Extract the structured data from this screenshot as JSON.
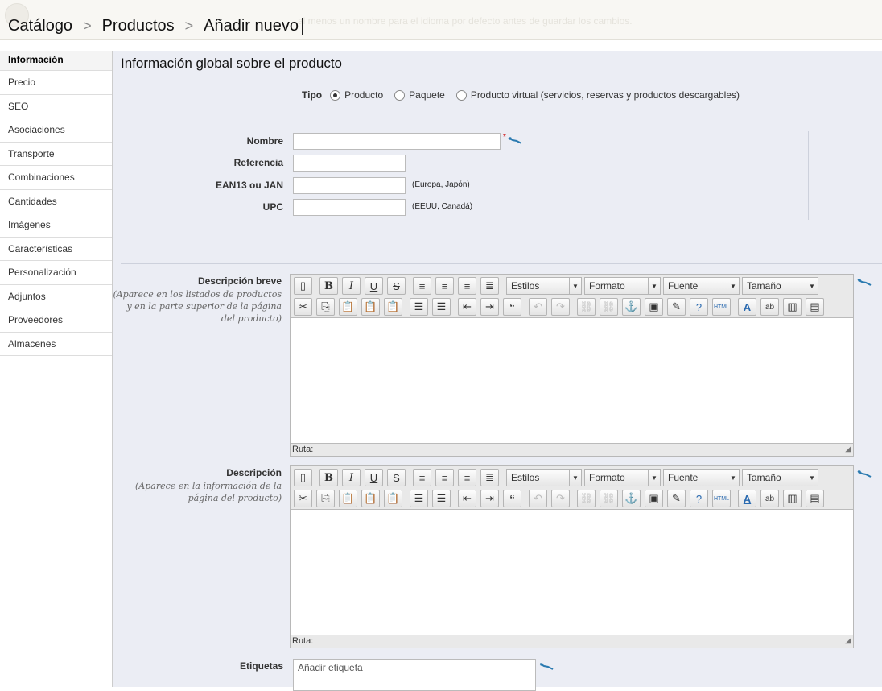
{
  "breadcrumb": {
    "items": [
      "Catálogo",
      "Productos",
      "Añadir nuevo"
    ],
    "separator": ">",
    "ghost_text": "al menos un nombre para el idioma por defecto antes de guardar los cambios."
  },
  "sidebar": {
    "items": [
      {
        "label": "Información"
      },
      {
        "label": "Precio"
      },
      {
        "label": "SEO"
      },
      {
        "label": "Asociaciones"
      },
      {
        "label": "Transporte"
      },
      {
        "label": "Combinaciones"
      },
      {
        "label": "Cantidades"
      },
      {
        "label": "Imágenes"
      },
      {
        "label": "Características"
      },
      {
        "label": "Personalización"
      },
      {
        "label": "Adjuntos"
      },
      {
        "label": "Proveedores"
      },
      {
        "label": "Almacenes"
      }
    ]
  },
  "main": {
    "title": "Información global sobre el producto",
    "tipo": {
      "label": "Tipo",
      "options": [
        "Producto",
        "Paquete",
        "Producto virtual (servicios, reservas y productos descargables)"
      ]
    },
    "fields": {
      "nombre": {
        "label": "Nombre",
        "value": "",
        "required": "*"
      },
      "referencia": {
        "label": "Referencia",
        "value": ""
      },
      "ean13": {
        "label": "EAN13 ou JAN",
        "value": "",
        "note": "(Europa, Japón)"
      },
      "upc": {
        "label": "UPC",
        "value": "",
        "note": "(EEUU, Canadá)"
      }
    },
    "short_description": {
      "label": "Descripción breve",
      "sub": "(Aparece en los listados de productos y en la parte superior de la página del producto)",
      "path": "Ruta:"
    },
    "description": {
      "label": "Descripción",
      "sub": "(Aparece en la información de la página del producto)",
      "path": "Ruta:"
    },
    "tags": {
      "label": "Etiquetas",
      "placeholder": "Añadir etiqueta"
    }
  },
  "editor_toolbar": {
    "styles": "Estilos",
    "format": "Formato",
    "font": "Fuente",
    "size": "Tamaño"
  },
  "colors": {
    "accent_blue": "#2a7ab0",
    "required_red": "#cc0000",
    "panel_bg": "#ebedf4"
  }
}
